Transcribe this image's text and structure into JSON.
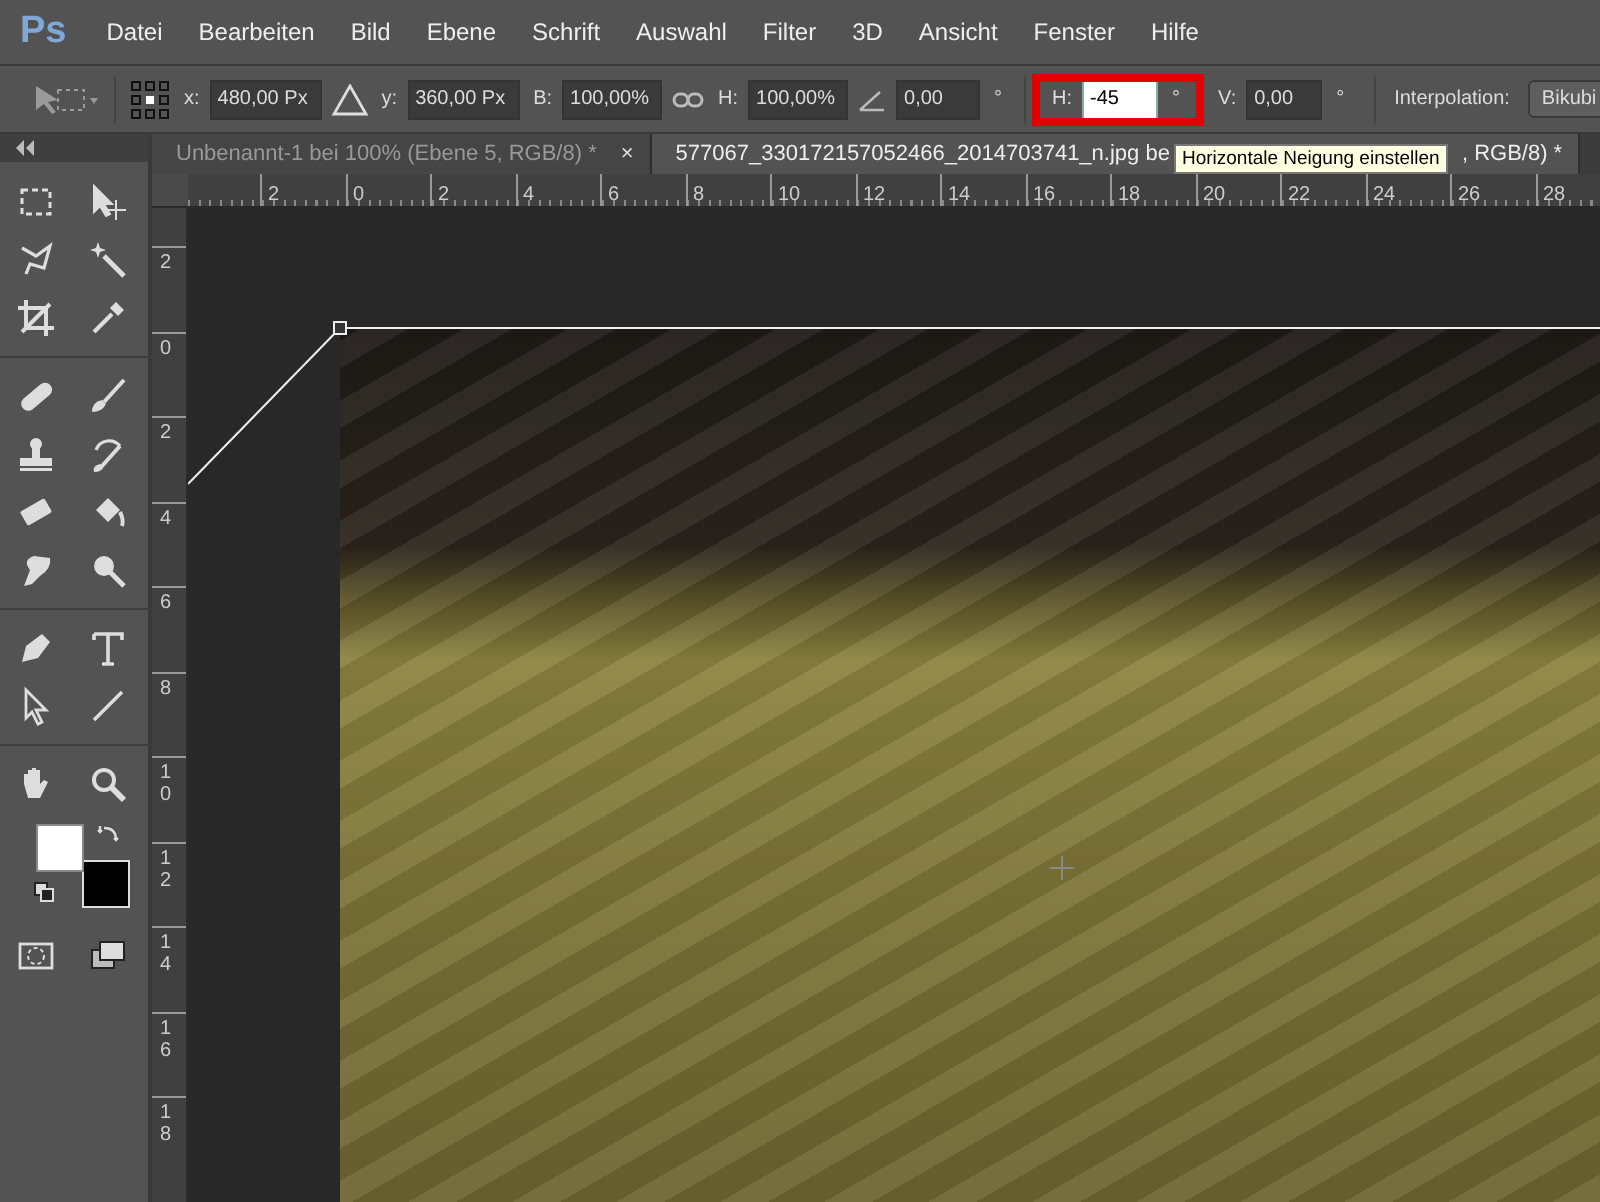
{
  "menu": {
    "logo": "Ps",
    "items": [
      "Datei",
      "Bearbeiten",
      "Bild",
      "Ebene",
      "Schrift",
      "Auswahl",
      "Filter",
      "3D",
      "Ansicht",
      "Fenster",
      "Hilfe"
    ]
  },
  "options": {
    "x": {
      "label": "x:",
      "value": "480,00 Px"
    },
    "y": {
      "label": "y:",
      "value": "360,00 Px"
    },
    "width": {
      "label": "B:",
      "value": "100,00%"
    },
    "height": {
      "label": "H:",
      "value": "100,00%"
    },
    "rotate": {
      "value": "0,00",
      "unit": "°"
    },
    "skew_h": {
      "label": "H:",
      "value": "-45",
      "unit": "°",
      "focused": true,
      "highlighted": true
    },
    "skew_v": {
      "label": "V:",
      "value": "0,00",
      "unit": "°",
      "focused": false
    },
    "interpolation": {
      "label": "Interpolation:",
      "value": "Bikubi"
    }
  },
  "tabs": [
    {
      "label": "Unbenannt-1 bei 100% (Ebene 5, RGB/8) *",
      "close": "×",
      "selected": false
    },
    {
      "label": "577067_330172157052466_2014703741_n.jpg be",
      "label_end": ", RGB/8) *",
      "selected": true
    }
  ],
  "tooltip": {
    "text": "Horizontale Neigung einstellen"
  },
  "rulers": {
    "horizontal": [
      "2",
      "0",
      "2",
      "4",
      "6",
      "8",
      "10",
      "12",
      "14",
      "16",
      "18",
      "20",
      "22",
      "24",
      "26",
      "28"
    ],
    "vertical": [
      "2",
      "0",
      "2",
      "4",
      "6",
      "8",
      "10",
      "12",
      "14",
      "16",
      "18"
    ]
  }
}
